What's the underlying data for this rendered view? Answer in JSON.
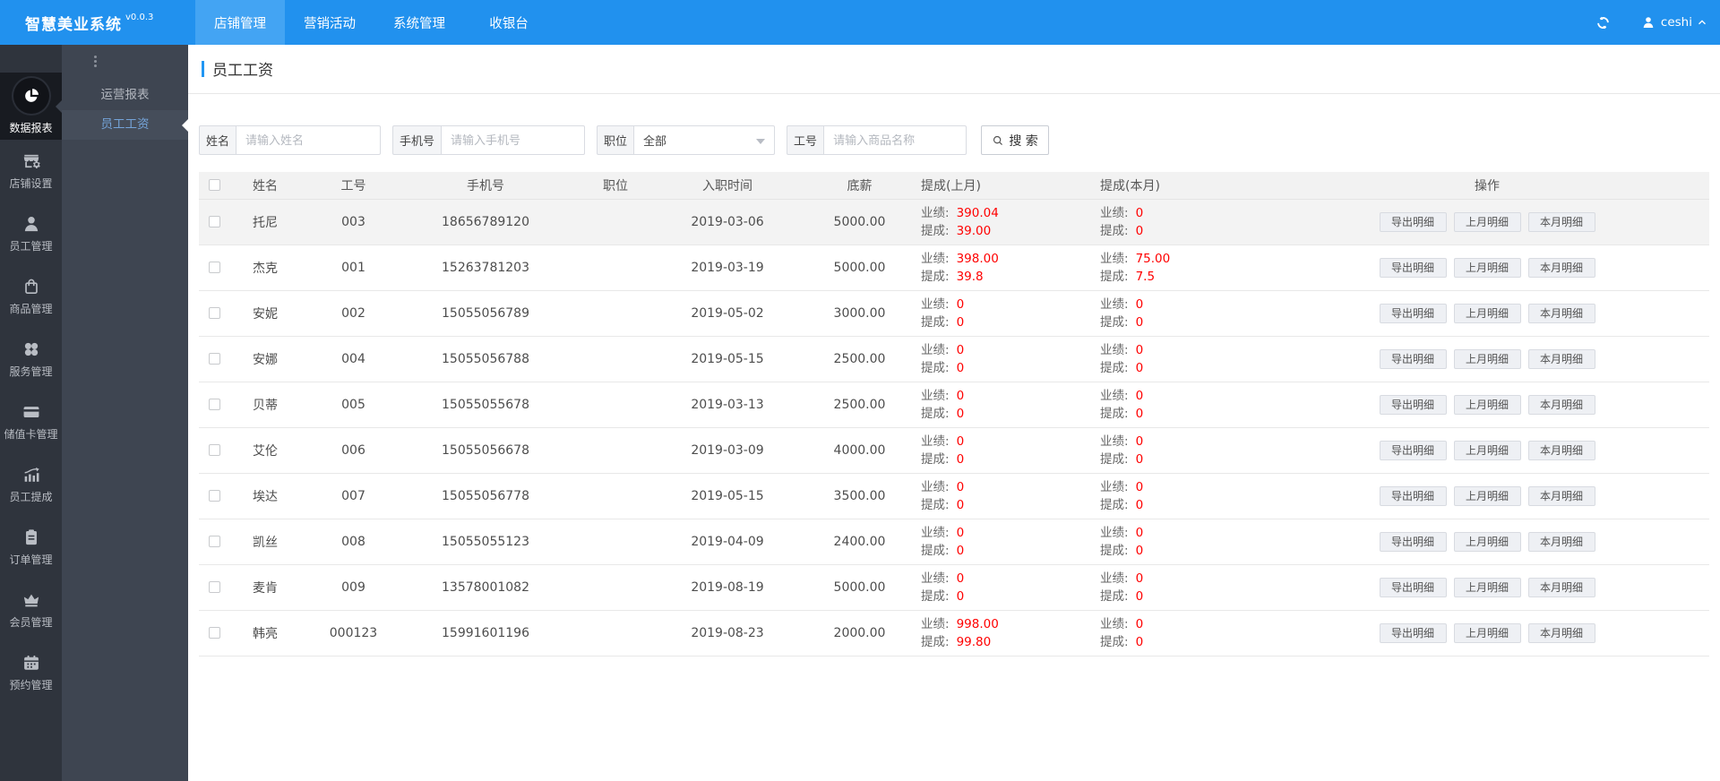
{
  "app": {
    "title": "智慧美业系统",
    "version": "v0.0.3"
  },
  "topnav": {
    "tabs": [
      {
        "label": "店铺管理",
        "active": true
      },
      {
        "label": "营销活动",
        "active": false
      },
      {
        "label": "系统管理",
        "active": false
      },
      {
        "label": "收银台",
        "active": false
      }
    ],
    "user": "ceshi"
  },
  "sidebar": {
    "items": [
      {
        "label": "数据报表",
        "icon": "pie-chart",
        "active": true
      },
      {
        "label": "店铺设置",
        "icon": "store",
        "active": false
      },
      {
        "label": "员工管理",
        "icon": "person",
        "active": false
      },
      {
        "label": "商品管理",
        "icon": "bag",
        "active": false
      },
      {
        "label": "服务管理",
        "icon": "clover",
        "active": false
      },
      {
        "label": "储值卡管理",
        "icon": "card",
        "active": false
      },
      {
        "label": "员工提成",
        "icon": "chart",
        "active": false
      },
      {
        "label": "订单管理",
        "icon": "clipboard",
        "active": false
      },
      {
        "label": "会员管理",
        "icon": "crown",
        "active": false
      },
      {
        "label": "预约管理",
        "icon": "calendar",
        "active": false
      }
    ]
  },
  "submenu": {
    "items": [
      {
        "label": "运营报表",
        "active": false
      },
      {
        "label": "员工工资",
        "active": true
      }
    ]
  },
  "page": {
    "title": "员工工资"
  },
  "filters": {
    "name": {
      "label": "姓名",
      "placeholder": "请输入姓名"
    },
    "phone": {
      "label": "手机号",
      "placeholder": "请输入手机号"
    },
    "position": {
      "label": "职位",
      "value": "全部"
    },
    "code": {
      "label": "工号",
      "placeholder": "请输入商品名称"
    },
    "search_label": "搜 索"
  },
  "table": {
    "headers": [
      "姓名",
      "工号",
      "手机号",
      "职位",
      "入职时间",
      "底薪",
      "提成(上月)",
      "提成(本月)",
      "操作"
    ],
    "perf_label": "业绩:",
    "comm_label": "提成:",
    "actions": [
      "导出明细",
      "上月明细",
      "本月明细"
    ],
    "rows": [
      {
        "name": "托尼",
        "code": "003",
        "phone": "18656789120",
        "position": "",
        "hire_date": "2019-03-06",
        "salary": "5000.00",
        "last_perf": "390.04",
        "last_comm": "39.00",
        "cur_perf": "0",
        "cur_comm": "0",
        "hovered": true
      },
      {
        "name": "杰克",
        "code": "001",
        "phone": "15263781203",
        "position": "",
        "hire_date": "2019-03-19",
        "salary": "5000.00",
        "last_perf": "398.00",
        "last_comm": "39.8",
        "cur_perf": "75.00",
        "cur_comm": "7.5",
        "hovered": false
      },
      {
        "name": "安妮",
        "code": "002",
        "phone": "15055056789",
        "position": "",
        "hire_date": "2019-05-02",
        "salary": "3000.00",
        "last_perf": "0",
        "last_comm": "0",
        "cur_perf": "0",
        "cur_comm": "0",
        "hovered": false
      },
      {
        "name": "安娜",
        "code": "004",
        "phone": "15055056788",
        "position": "",
        "hire_date": "2019-05-15",
        "salary": "2500.00",
        "last_perf": "0",
        "last_comm": "0",
        "cur_perf": "0",
        "cur_comm": "0",
        "hovered": false
      },
      {
        "name": "贝蒂",
        "code": "005",
        "phone": "15055055678",
        "position": "",
        "hire_date": "2019-03-13",
        "salary": "2500.00",
        "last_perf": "0",
        "last_comm": "0",
        "cur_perf": "0",
        "cur_comm": "0",
        "hovered": false
      },
      {
        "name": "艾伦",
        "code": "006",
        "phone": "15055056678",
        "position": "",
        "hire_date": "2019-03-09",
        "salary": "4000.00",
        "last_perf": "0",
        "last_comm": "0",
        "cur_perf": "0",
        "cur_comm": "0",
        "hovered": false
      },
      {
        "name": "埃达",
        "code": "007",
        "phone": "15055056778",
        "position": "",
        "hire_date": "2019-05-15",
        "salary": "3500.00",
        "last_perf": "0",
        "last_comm": "0",
        "cur_perf": "0",
        "cur_comm": "0",
        "hovered": false
      },
      {
        "name": "凯丝",
        "code": "008",
        "phone": "15055055123",
        "position": "",
        "hire_date": "2019-04-09",
        "salary": "2400.00",
        "last_perf": "0",
        "last_comm": "0",
        "cur_perf": "0",
        "cur_comm": "0",
        "hovered": false
      },
      {
        "name": "麦肯",
        "code": "009",
        "phone": "13578001082",
        "position": "",
        "hire_date": "2019-08-19",
        "salary": "5000.00",
        "last_perf": "0",
        "last_comm": "0",
        "cur_perf": "0",
        "cur_comm": "0",
        "hovered": false
      },
      {
        "name": "韩亮",
        "code": "000123",
        "phone": "15991601196",
        "position": "",
        "hire_date": "2019-08-23",
        "salary": "2000.00",
        "last_perf": "998.00",
        "last_comm": "99.80",
        "cur_perf": "0",
        "cur_comm": "0",
        "hovered": false
      }
    ]
  },
  "colors": {
    "accent": "#2196f3",
    "topbar": "#2191ee",
    "topbar_active": "#43a4f3",
    "red": "#ff0000"
  }
}
